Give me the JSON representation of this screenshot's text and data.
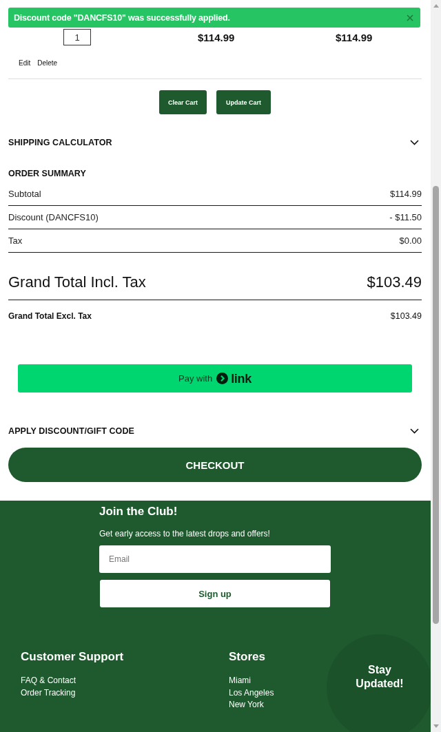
{
  "toast": {
    "message": "Discount code \"DANCFS10\" was successfully applied."
  },
  "cart_item": {
    "quantity": "1",
    "price": "$114.99",
    "row_total": "$114.99",
    "actions": [
      "Edit",
      "Delete"
    ]
  },
  "cart_buttons": [
    "Clear Cart",
    "Update Cart"
  ],
  "shipping_calculator": {
    "title": "SHIPPING CALCULATOR",
    "expanded": false
  },
  "order_summary": {
    "title": "ORDER SUMMARY",
    "rows": [
      {
        "label": "Subtotal",
        "value": "$114.99"
      },
      {
        "label": "Discount (DANCFS10)",
        "value": "- $11.50"
      },
      {
        "label": "Tax",
        "value": "$0.00"
      }
    ],
    "grand_total": {
      "label": "Grand Total Incl. Tax",
      "value": "$103.49"
    },
    "grand_total_excl": {
      "label": "Grand Total Excl. Tax",
      "value": "$103.49"
    }
  },
  "pay_button": {
    "label": "Pay with",
    "brand": "link"
  },
  "discount_section": {
    "title": "APPLY DISCOUNT/GIFT CODE",
    "expanded": false
  },
  "checkout": {
    "label": "CHECKOUT"
  },
  "footer": {
    "newsletter": {
      "title": "Join the Club!",
      "text": "Get early access to the latest drops and offers!",
      "placeholder": "Email",
      "button": "Sign up"
    },
    "columns": [
      {
        "title": "Customer Support",
        "links": [
          "FAQ & Contact",
          "Order Tracking"
        ]
      },
      {
        "title": "Stores",
        "links": [
          "Miami",
          "Los Angeles",
          "New York"
        ]
      }
    ]
  },
  "floating_button": {
    "label": "Stay Updated!"
  }
}
